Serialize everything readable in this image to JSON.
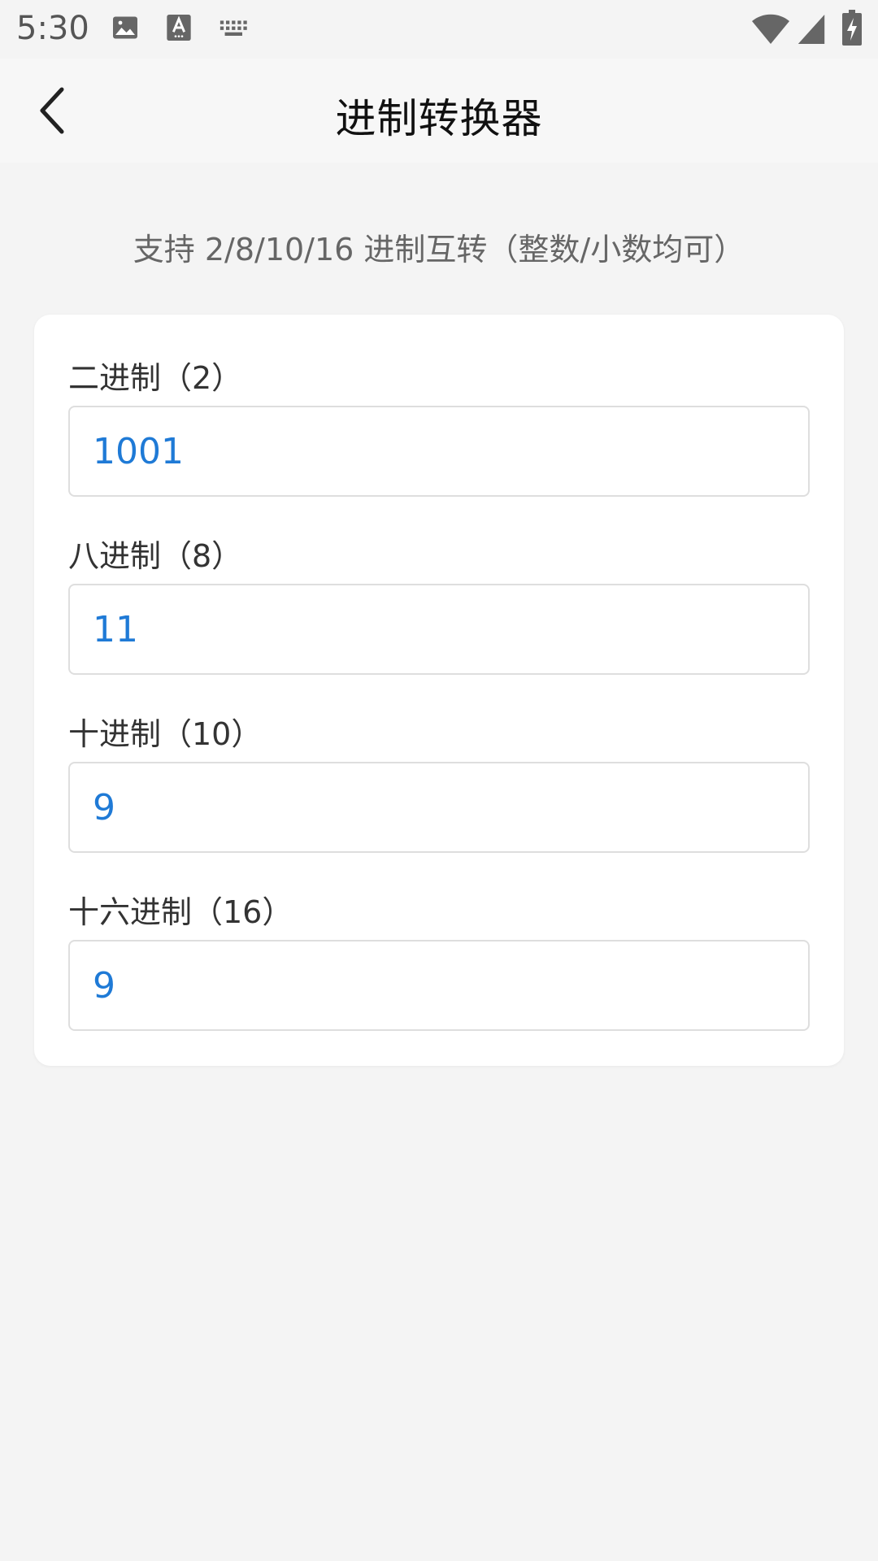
{
  "status_bar": {
    "time": "5:30",
    "icons": [
      "image-icon",
      "text-a-icon",
      "keyboard-icon",
      "wifi-icon",
      "signal-icon",
      "battery-charging-icon"
    ]
  },
  "header": {
    "title": "进制转换器",
    "back_icon": "chevron-left-icon"
  },
  "subtitle": "支持 2/8/10/16 进制互转（整数/小数均可）",
  "fields": [
    {
      "label": "二进制（2）",
      "value": "1001"
    },
    {
      "label": "八进制（8）",
      "value": "11"
    },
    {
      "label": "十进制（10）",
      "value": "9"
    },
    {
      "label": "十六进制（16）",
      "value": "9"
    }
  ],
  "colors": {
    "accent": "#1f7ad6",
    "background": "#f4f4f4",
    "card": "#ffffff"
  }
}
